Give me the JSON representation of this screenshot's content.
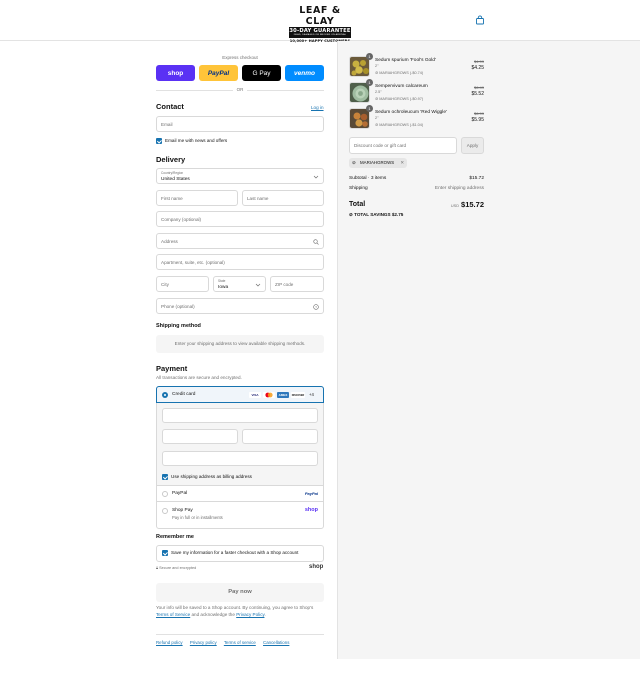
{
  "header": {
    "logo_title": "LEAF & CLAY",
    "logo_badge": "30-DAY GUARANTEE",
    "logo_badge_sub": "DEAD, DAMAGED OR BROKEN ON ARRIVAL",
    "logo_tagline": "10,000+ HAPPY CUSTOMERS"
  },
  "express": {
    "label": "Express checkout",
    "shop": "shop",
    "paypal": "PayPal",
    "gpay": "G Pay",
    "venmo": "venmo",
    "or": "OR"
  },
  "contact": {
    "heading": "Contact",
    "login": "Log in",
    "email_placeholder": "Email",
    "news_label": "Email me with news and offers"
  },
  "delivery": {
    "heading": "Delivery",
    "country_label": "Country/Region",
    "country_value": "United States",
    "first_name": "First name",
    "last_name": "Last name",
    "company": "Company (optional)",
    "address": "Address",
    "apartment": "Apartment, suite, etc. (optional)",
    "city": "City",
    "state_label": "State",
    "state_value": "Iowa",
    "zip": "ZIP code",
    "phone": "Phone (optional)"
  },
  "shipping": {
    "heading": "Shipping method",
    "note": "Enter your shipping address to view available shipping methods."
  },
  "payment": {
    "heading": "Payment",
    "subtitle": "All transactions are secure and encrypted.",
    "credit_card": "Credit card",
    "brands": [
      "VISA",
      "MC",
      "AMEX",
      "DISCOVER"
    ],
    "more": "+4",
    "billing_label": "Use shipping address as billing address",
    "paypal": "PayPal",
    "paypal_logo": "PayPal",
    "shop_pay": "Shop Pay",
    "shop_pay_sub": "Pay in full or in installments",
    "shop_logo": "shop"
  },
  "remember": {
    "heading": "Remember me",
    "label": "Save my information for a faster checkout with a Shop account",
    "secure": "Secure and encrypted",
    "shop_logo": "shop"
  },
  "pay_now": "Pay now",
  "terms": {
    "pre": "Your info will be saved to a Shop account. By continuing, you agree to Shop's ",
    "tos": "Terms of Service",
    "mid": " and acknowledge the ",
    "privacy": "Privacy Policy",
    "post": "."
  },
  "footer": [
    "Refund policy",
    "Privacy policy",
    "Terms of service",
    "Cancellations"
  ],
  "summary": {
    "items": [
      {
        "qty": "1",
        "name": "Sedum spurium 'Fool's Gold'",
        "variant": "2\"",
        "discount": "MARIAHGROWS (-$0.74)",
        "old_price": "$4.99",
        "price": "$4.25"
      },
      {
        "qty": "1",
        "name": "Sempervivum calcareum",
        "variant": "2.5\"",
        "discount": "MARIAHGROWS (-$0.97)",
        "old_price": "$6.49",
        "price": "$5.52"
      },
      {
        "qty": "1",
        "name": "Sedum ochroleucum 'Red Wiggle'",
        "variant": "2\"",
        "discount": "MARIAHGROWS (-$1.04)",
        "old_price": "$6.99",
        "price": "$5.95"
      }
    ],
    "discount_placeholder": "Discount code or gift card",
    "apply": "Apply",
    "code_tag": "MARIAHGROWS",
    "subtotal_label": "Subtotal · 3 items",
    "subtotal_value": "$15.72",
    "shipping_label": "Shipping",
    "shipping_value": "Enter shipping address",
    "total_label": "Total",
    "currency": "USD",
    "total_value": "$15.72",
    "savings_label": "TOTAL SAVINGS",
    "savings_value": "$2.75"
  }
}
